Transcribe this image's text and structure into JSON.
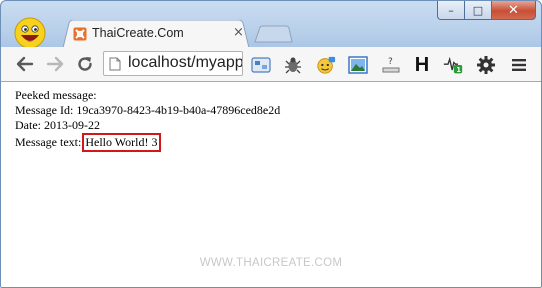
{
  "window": {
    "minimize_glyph": "–",
    "maximize_glyph": "□",
    "close_glyph": "✕"
  },
  "tab": {
    "title": "ThaiCreate.Com",
    "close_glyph": "×",
    "favicon": "thaicreate-favicon",
    "accent": "#e8702a"
  },
  "toolbar": {
    "url": "localhost/myapp",
    "back_icon": "back-arrow-icon",
    "forward_icon": "forward-arrow-icon",
    "reload_icon": "reload-icon",
    "extensions": [
      "screenshot-icon",
      "bug-icon",
      "badge-icon",
      "image-icon",
      "question-icon",
      "h-icon",
      "pulse-icon",
      "gear-icon",
      "menu-icon"
    ],
    "h_letter": "H",
    "question_mark": "?",
    "pulse_badge": "1"
  },
  "content": {
    "line1": "Peeked message:",
    "line2": "Message Id: 19ca3970-8423-4b19-b40a-47896ced8e2d",
    "line3": "Date: 2013-09-22",
    "line4_label": "Message text:",
    "line4_value": "Hello World! 3",
    "highlight_color": "#d01818"
  },
  "watermark": "WWW.THAICREATE.COM"
}
